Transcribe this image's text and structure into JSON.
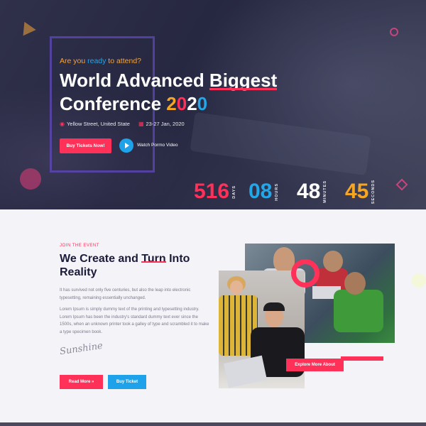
{
  "hero": {
    "eyebrow_pre": "Are you ",
    "eyebrow_hl": "ready",
    "eyebrow_post": " to attend?",
    "title_line1_a": "World Advanced ",
    "title_line1_b": "Biggest",
    "title_line2": "Conference ",
    "year": [
      "2",
      "0",
      "2",
      "0"
    ],
    "location": "Yellow Street, United State",
    "date": "23-27 Jan, 2020",
    "buy_label": "Buy Tickets Now!",
    "video_label": "Watch Pormo Video"
  },
  "countdown": [
    {
      "value": "516",
      "label": "DAYS",
      "color": "#ff3159"
    },
    {
      "value": "08",
      "label": "HOURS",
      "color": "#22a7e8"
    },
    {
      "value": "48",
      "label": "MINUTES",
      "color": "#ffffff"
    },
    {
      "value": "45",
      "label": "SECONDS",
      "color": "#f5a623"
    }
  ],
  "about": {
    "eyebrow": "JOIN THE EVENT",
    "title_a": "We Create and ",
    "title_u": "Turn",
    "title_b": " Into",
    "title_line2": "Reality",
    "para1": "It has survived not only five centuries, but also the leap into electronic typesetting, remaining essentially unchanged.",
    "para2": "Lorem Ipsum is simply dummy text of the printing and typesetting industry. Lorem Ipsum has been the industry's standard dummy text ever since the 1500s, when an unknown printer took a galley of type and scrambled it to make a type specimen book.",
    "signature": "Sunshine",
    "read_more": "Read More »",
    "buy_ticket": "Buy Ticket",
    "explore": "Explore More About"
  },
  "colors": {
    "accent_red": "#ff3159",
    "accent_blue": "#22a7e8",
    "accent_yellow": "#f5a623",
    "heading": "#1b1b3a"
  },
  "icons": {
    "location": "map-pin-icon",
    "date": "calendar-icon",
    "play": "play-icon"
  }
}
